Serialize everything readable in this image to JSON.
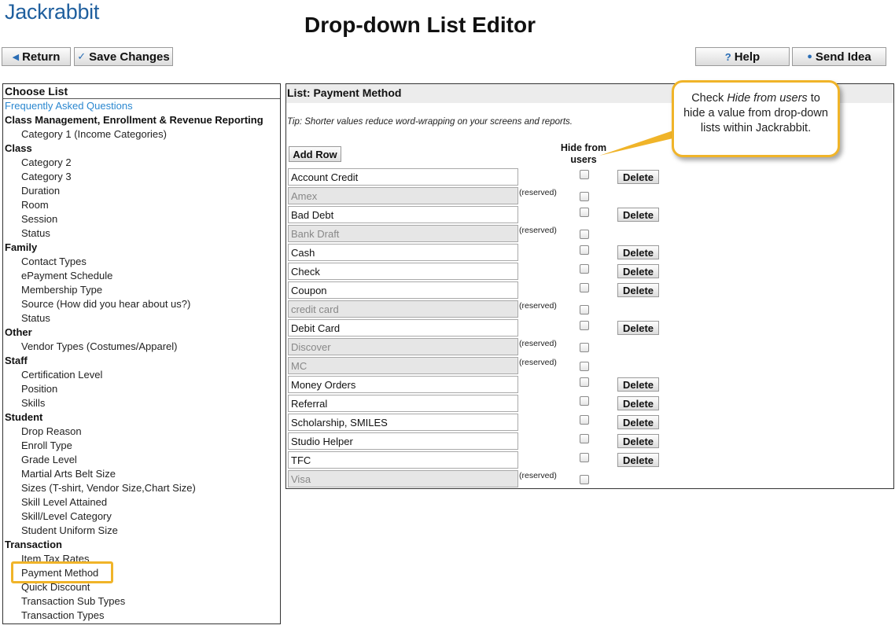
{
  "brand": {
    "logo_text": "Jackrabbit"
  },
  "page": {
    "title": "Drop-down List Editor"
  },
  "toolbar": {
    "return_label": "Return",
    "save_label": "Save Changes",
    "help_label": "Help",
    "idea_label": "Send Idea",
    "return_icon": "triangle-left-icon",
    "save_icon": "check-icon",
    "help_icon": "question-icon",
    "idea_icon": "lightbulb-icon"
  },
  "left": {
    "heading": "Choose List",
    "faq_link": "Frequently Asked Questions",
    "groups": [
      {
        "name": "Class Management, Enrollment & Revenue Reporting",
        "items": [
          "Category 1 (Income Categories)"
        ]
      },
      {
        "name": "Class",
        "items": [
          "Category 2",
          "Category 3",
          "Duration",
          "Room",
          "Session",
          "Status"
        ]
      },
      {
        "name": "Family",
        "items": [
          "Contact Types",
          "ePayment Schedule",
          "Membership Type",
          "Source (How did you hear about us?)",
          "Status"
        ]
      },
      {
        "name": "Other",
        "items": [
          "Vendor Types (Costumes/Apparel)"
        ]
      },
      {
        "name": "Staff",
        "items": [
          "Certification Level",
          "Position",
          "Skills"
        ]
      },
      {
        "name": "Student",
        "items": [
          "Drop Reason",
          "Enroll Type",
          "Grade Level",
          "Martial Arts Belt Size",
          "Sizes (T-shirt, Vendor Size,Chart Size)",
          "Skill Level Attained",
          "Skill/Level Category",
          "Student Uniform Size"
        ]
      },
      {
        "name": "Transaction",
        "items": [
          "Item Tax Rates",
          "Payment Method",
          "Quick Discount",
          "Transaction Sub Types",
          "Transaction Types"
        ]
      }
    ],
    "selected_item": "Payment Method"
  },
  "right": {
    "heading": "List: Payment Method",
    "tip": "Tip: Shorter values reduce word-wrapping on your screens and reports.",
    "add_row_label": "Add Row",
    "hide_col_label": "Hide from users",
    "delete_label": "Delete",
    "reserved_label": "(reserved)",
    "rows": [
      {
        "value": "Account Credit",
        "reserved": false,
        "hidden": false
      },
      {
        "value": "Amex",
        "reserved": true,
        "hidden": false
      },
      {
        "value": "Bad Debt",
        "reserved": false,
        "hidden": false
      },
      {
        "value": "Bank Draft",
        "reserved": true,
        "hidden": false
      },
      {
        "value": "Cash",
        "reserved": false,
        "hidden": false
      },
      {
        "value": "Check",
        "reserved": false,
        "hidden": false
      },
      {
        "value": "Coupon",
        "reserved": false,
        "hidden": false
      },
      {
        "value": "credit card",
        "reserved": true,
        "hidden": false
      },
      {
        "value": "Debit Card",
        "reserved": false,
        "hidden": false
      },
      {
        "value": "Discover",
        "reserved": true,
        "hidden": false
      },
      {
        "value": "MC",
        "reserved": true,
        "hidden": false
      },
      {
        "value": "Money Orders",
        "reserved": false,
        "hidden": false
      },
      {
        "value": "Referral",
        "reserved": false,
        "hidden": false
      },
      {
        "value": "Scholarship, SMILES",
        "reserved": false,
        "hidden": false
      },
      {
        "value": "Studio Helper",
        "reserved": false,
        "hidden": false
      },
      {
        "value": "TFC",
        "reserved": false,
        "hidden": false
      },
      {
        "value": "Visa",
        "reserved": true,
        "hidden": false
      }
    ]
  },
  "callout": {
    "prefix": "Check ",
    "emphasis": "Hide from users",
    "suffix": " to hide a value from drop-down lists within Jackrabbit."
  },
  "colors": {
    "brand": "#1f5f9e",
    "link": "#2a87d0",
    "highlight": "#f0b429",
    "icon": "#2a6db5"
  }
}
